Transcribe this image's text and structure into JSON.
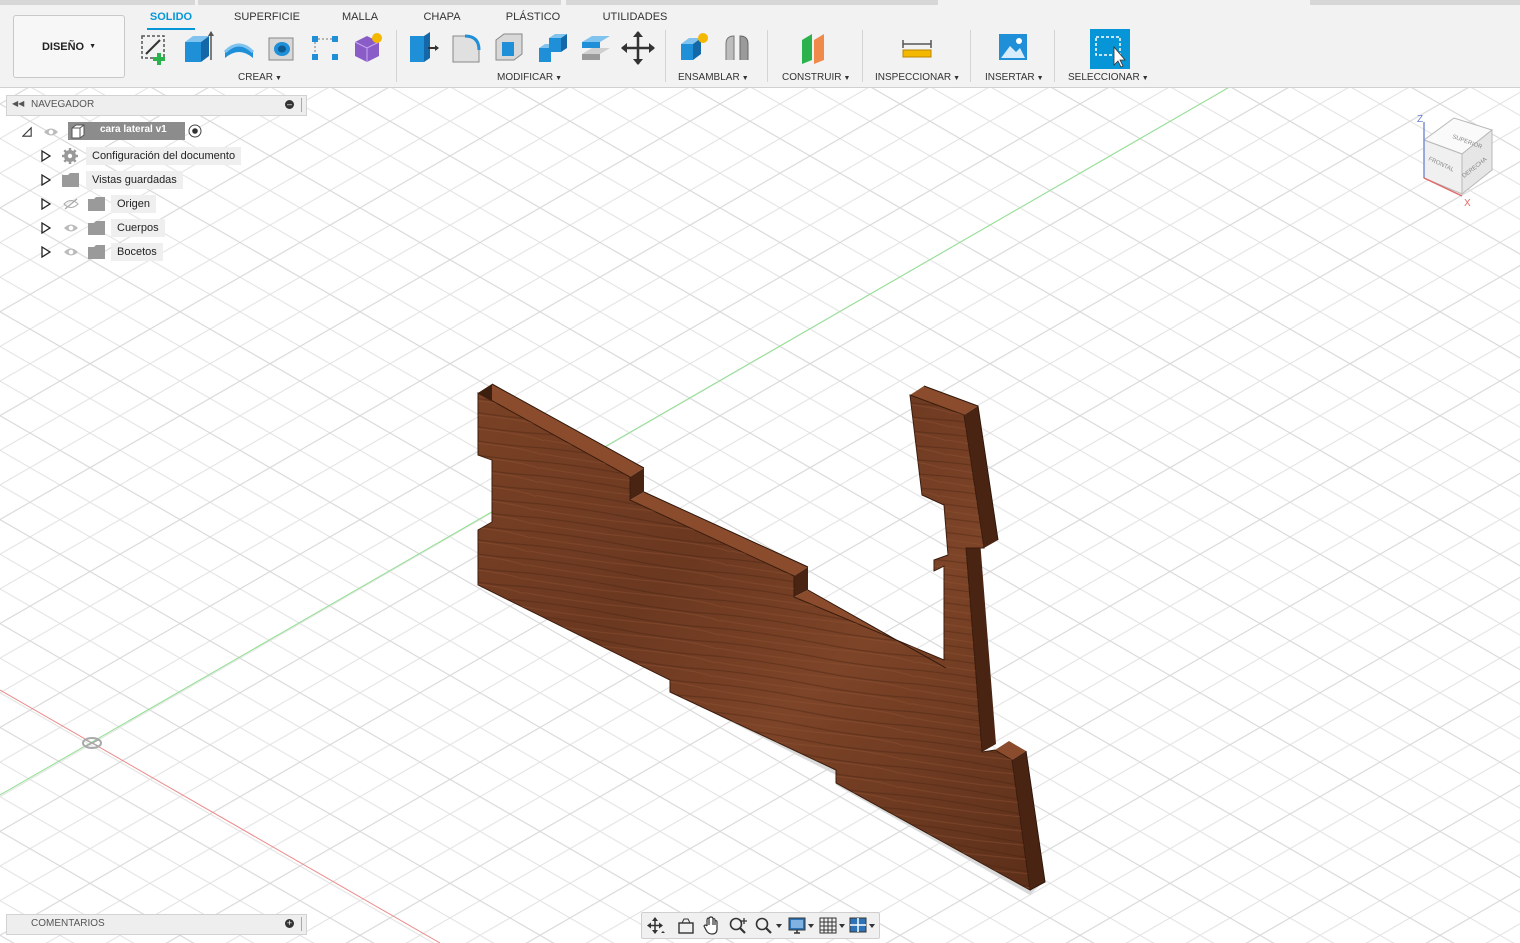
{
  "workspace": {
    "label": "DISEÑO"
  },
  "tabs": [
    {
      "label": "SOLIDO",
      "active": true
    },
    {
      "label": "SUPERFICIE",
      "active": false
    },
    {
      "label": "MALLA",
      "active": false
    },
    {
      "label": "CHAPA",
      "active": false
    },
    {
      "label": "PLÁSTICO",
      "active": false
    },
    {
      "label": "UTILIDADES",
      "active": false
    }
  ],
  "groups": {
    "crear": "CREAR",
    "modificar": "MODIFICAR",
    "ensamblar": "ENSAMBLAR",
    "construir": "CONSTRUIR",
    "inspeccionar": "INSPECCIONAR",
    "insertar": "INSERTAR",
    "seleccionar": "SELECCIONAR"
  },
  "navigator": {
    "title": "NAVEGADOR",
    "root": "cara lateral v1",
    "items": [
      {
        "label": "Configuración del documento",
        "icon": "gear-icon"
      },
      {
        "label": "Vistas guardadas",
        "icon": "folder-icon"
      },
      {
        "label": "Origen",
        "icon": "folder-icon",
        "visibility": "hidden"
      },
      {
        "label": "Cuerpos",
        "icon": "folder-icon",
        "visibility": "visible"
      },
      {
        "label": "Bocetos",
        "icon": "folder-icon",
        "visibility": "visible"
      }
    ]
  },
  "viewcube": {
    "top": "SUPERIOR",
    "front": "FRONTAL",
    "right": "DERECHA",
    "axis_z": "Z",
    "axis_x": "X"
  },
  "comments": {
    "title": "COMENTARIOS"
  },
  "colors": {
    "accent": "#0696d7",
    "wood": "#6e3a1f",
    "wood_dark": "#3d1f0f",
    "grid": "#e3e3e3",
    "axis_green": "#7fdc7f",
    "axis_red": "#e88080"
  }
}
